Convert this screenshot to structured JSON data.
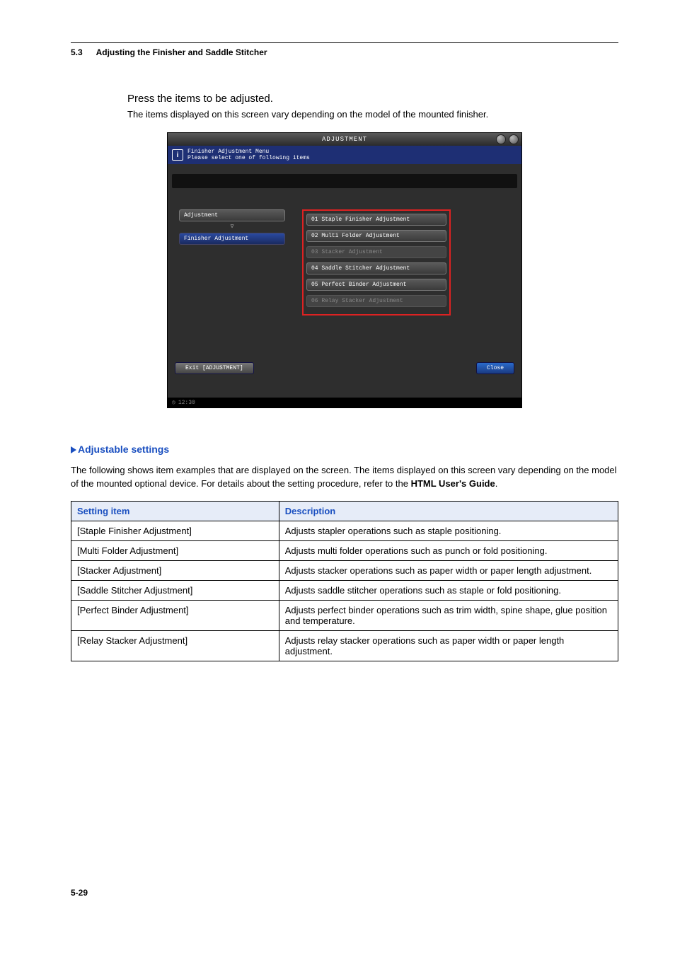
{
  "header": {
    "section_num": "5.3",
    "section_title": "Adjusting the Finisher and Saddle Stitcher"
  },
  "instruction": "Press the items to be adjusted.",
  "instruction_sub": "The items displayed on this screen vary depending on the model of the mounted finisher.",
  "screenshot": {
    "title": "ADJUSTMENT",
    "info_line1": "Finisher Adjustment Menu",
    "info_line2": "Please select one of following items",
    "left_items": [
      "Adjustment",
      "Finisher Adjustment"
    ],
    "right_items": [
      {
        "label": "01 Staple Finisher Adjustment",
        "enabled": true
      },
      {
        "label": "02 Multi Folder Adjustment",
        "enabled": true
      },
      {
        "label": "03 Stacker Adjustment",
        "enabled": false
      },
      {
        "label": "04 Saddle Stitcher Adjustment",
        "enabled": true
      },
      {
        "label": "05 Perfect Binder Adjustment",
        "enabled": true
      },
      {
        "label": "06 Relay Stacker Adjustment",
        "enabled": false
      }
    ],
    "exit_label": "Exit [ADJUSTMENT]",
    "close_label": "Close",
    "clock": "12:30"
  },
  "section": {
    "heading": "Adjustable settings",
    "paragraph_pre": "The following shows item examples that are displayed on the screen. The items displayed on this screen vary depending on the model of the mounted optional device. For details about the setting procedure, refer to the ",
    "paragraph_bold": "HTML User's Guide",
    "paragraph_post": "."
  },
  "table": {
    "head_item": "Setting item",
    "head_desc": "Description",
    "rows": [
      {
        "item": "[Staple Finisher Adjustment]",
        "desc": "Adjusts stapler operations such as staple positioning."
      },
      {
        "item": "[Multi Folder Adjustment]",
        "desc": "Adjusts multi folder operations such as punch or fold positioning."
      },
      {
        "item": "[Stacker Adjustment]",
        "desc": "Adjusts stacker operations such as paper width or paper length adjustment."
      },
      {
        "item": "[Saddle Stitcher Adjustment]",
        "desc": "Adjusts saddle stitcher operations such as staple or fold positioning."
      },
      {
        "item": "[Perfect Binder Adjustment]",
        "desc": "Adjusts perfect binder operations such as trim width, spine shape, glue position and temperature."
      },
      {
        "item": "[Relay Stacker Adjustment]",
        "desc": "Adjusts relay stacker operations such as paper width or paper length adjustment."
      }
    ]
  },
  "page_number": "5-29"
}
